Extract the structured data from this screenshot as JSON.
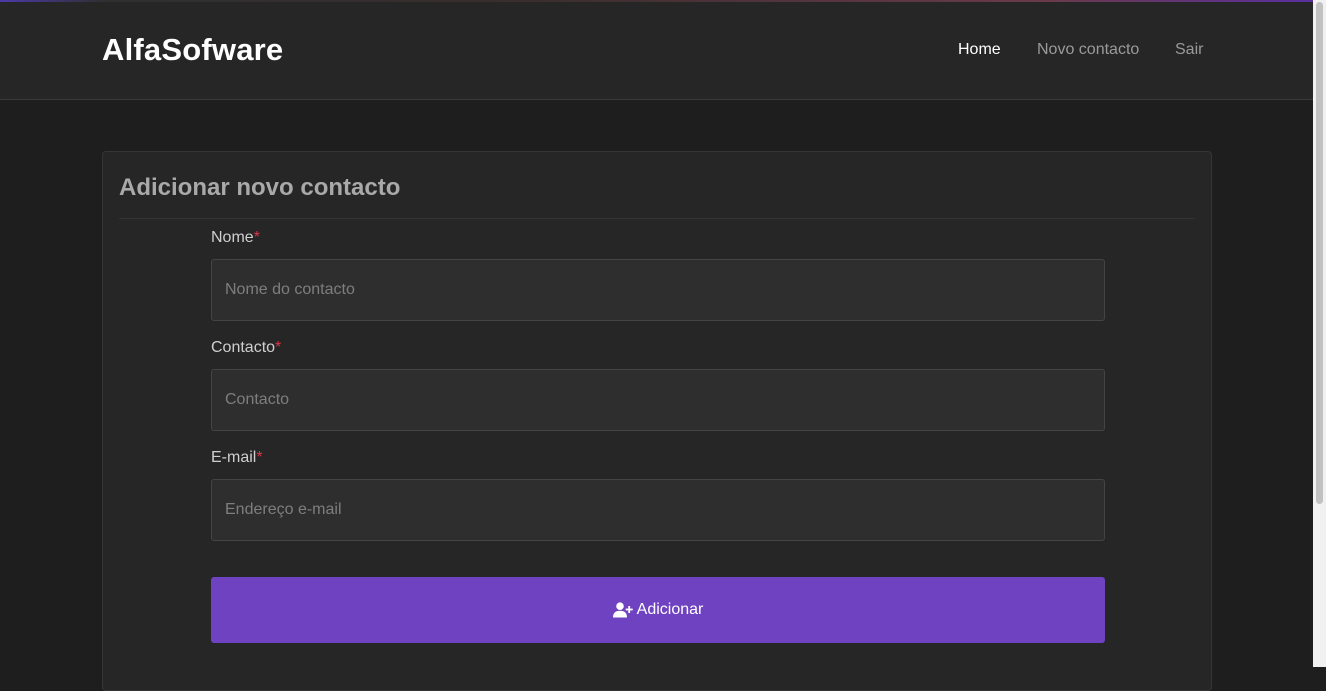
{
  "navbar": {
    "brand": "AlfaSofware",
    "links": [
      {
        "label": "Home",
        "active": true
      },
      {
        "label": "Novo contacto",
        "active": false
      },
      {
        "label": "Sair",
        "active": false
      }
    ]
  },
  "form": {
    "title": "Adicionar novo contacto",
    "required_mark": "*",
    "fields": [
      {
        "label": "Nome",
        "placeholder": "Nome do contacto",
        "value": ""
      },
      {
        "label": "Contacto",
        "placeholder": "Contacto",
        "value": ""
      },
      {
        "label": "E-mail",
        "placeholder": "Endereço e-mail",
        "value": ""
      }
    ],
    "submit_label": "Adicionar",
    "submit_icon": "user-plus-icon"
  },
  "colors": {
    "accent": "#6f42c1",
    "required": "#dc3545",
    "background": "#1e1e1e",
    "surface": "#262626"
  }
}
